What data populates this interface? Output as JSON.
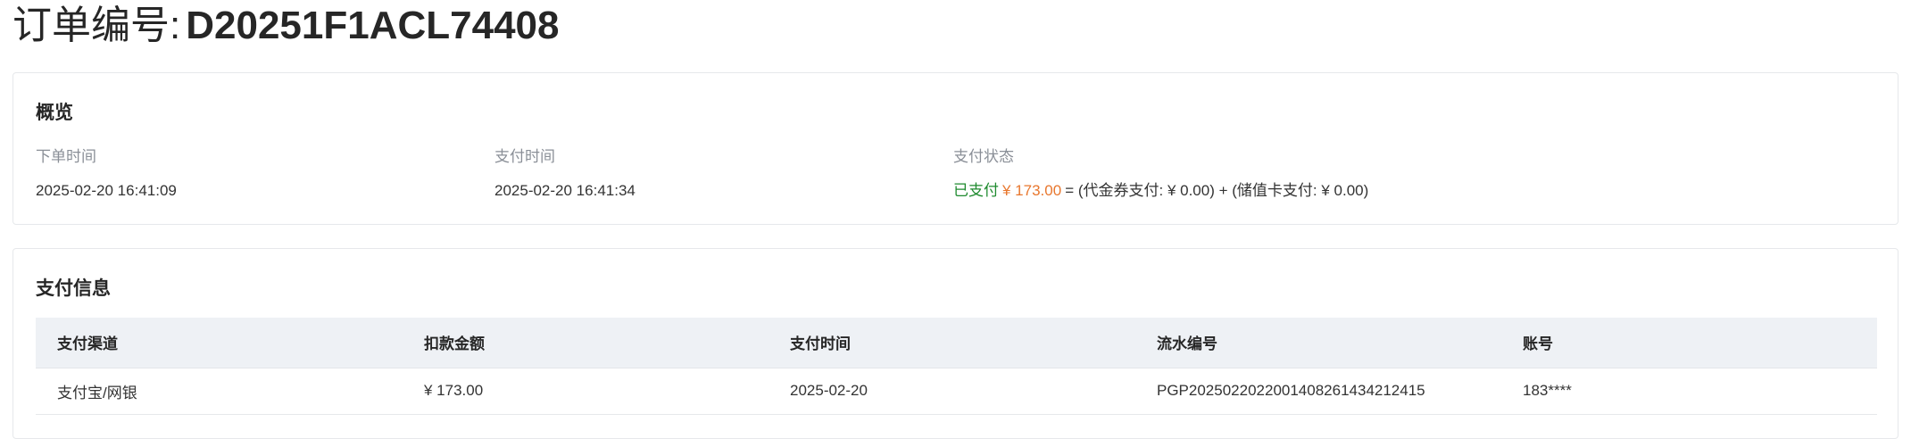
{
  "header": {
    "title_prefix": "订单编号:",
    "order_no": "D20251F1ACL74408"
  },
  "overview": {
    "title": "概览",
    "fields": [
      {
        "label": "下单时间",
        "value": "2025-02-20 16:41:09"
      },
      {
        "label": "支付时间",
        "value": "2025-02-20 16:41:34"
      }
    ],
    "status": {
      "label": "支付状态",
      "paid_text": "已支付",
      "amount": "¥ 173.00",
      "breakdown": "= (代金券支付: ¥ 0.00) + (储值卡支付: ¥ 0.00)"
    }
  },
  "payment_info": {
    "title": "支付信息",
    "columns": [
      "支付渠道",
      "扣款金额",
      "支付时间",
      "流水编号",
      "账号"
    ],
    "rows": [
      [
        "支付宝/网银",
        "¥ 173.00",
        "2025-02-20",
        "PGP20250220220014082614342124​15",
        "183****"
      ]
    ]
  },
  "colors": {
    "paid_status": "#1e8a2e",
    "amount": "#e8772e",
    "table_header_bg": "#eef1f5"
  }
}
